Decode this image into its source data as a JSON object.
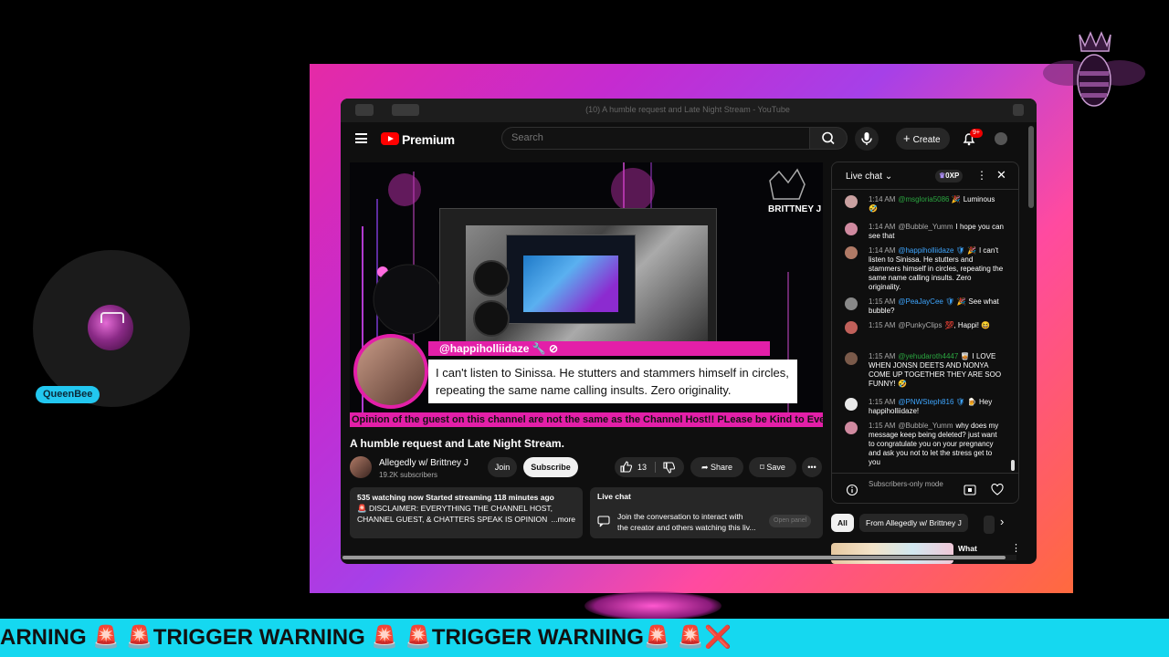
{
  "overlay": {
    "username": "QueenBee",
    "warning_ticker": "ARNING 🚨 🚨TRIGGER WARNING 🚨 🚨TRIGGER WARNING🚨  🚨❌"
  },
  "browser": {
    "tab_title": "(10) A humble request and Late Night Stream - YouTube"
  },
  "topbar": {
    "brand": "Premium",
    "search_placeholder": "Search",
    "create_label": "Create",
    "notification_count": "9+"
  },
  "video": {
    "highlight_author": "@happiholliidaze 🔧 ⊘",
    "highlight_message": "I can't listen to Sinissa. He stutters and stammers himself in circles, repeating the same name calling insults. Zero originality.",
    "ticker": "Opinion of the guest on this channel are not the same as the Channel Host!! PLease be Kind to Eve",
    "watermark": "BRITTNEY J"
  },
  "video_info": {
    "title": "A humble request and Late Night Stream.",
    "channel_name": "Allegedly w/ Brittney J",
    "subscribers": "19.2K subscribers",
    "join_label": "Join",
    "subscribe_label": "Subscribe",
    "like_count": "13",
    "share_label": "Share",
    "save_label": "Save",
    "more_label": "•••"
  },
  "description": {
    "stats": "535 watching now  Started streaming 118 minutes ago",
    "line1": "🚨 DISCLAIMER: EVERYTHING THE CHANNEL HOST,",
    "line2": "CHANNEL GUEST, & CHATTERS SPEAK IS OPINION 🚨",
    "more": "...more"
  },
  "live_chat_box": {
    "title": "Live chat",
    "text_line1": "Join the conversation to interact with",
    "text_line2": "the creator and others watching this liv...",
    "open_panel": "Open panel"
  },
  "chat": {
    "title": "Live chat",
    "xp": "0XP",
    "messages": [
      {
        "time": "1:14 AM",
        "author": "@msgloria5086 🎉",
        "text": "Luminous 🤣",
        "color": "#c9a0a0"
      },
      {
        "time": "1:14 AM",
        "author": "@Bubble_Yumm",
        "text": "I hope you can see that",
        "color": "#d08aa0"
      },
      {
        "time": "1:14 AM",
        "author": "@happiholliidaze 🛡 🎉",
        "text": "I can't listen to Sinissa. He stutters and stammers himself in circles, repeating the same name calling insults. Zero originality.",
        "color": "#b07a66"
      },
      {
        "time": "1:15 AM",
        "author": "@PeaJayCee 🛡 🎉",
        "text": "See what bubble?",
        "color": "#888"
      },
      {
        "time": "1:15 AM",
        "author": "@PunkyClips",
        "text": "💯, Happi! 😆",
        "color": "#c0605a"
      },
      {
        "time": "1:15 AM",
        "author": "@yehudaroth4447 🥃",
        "text": "I LOVE WHEN JONSN DEETS AND NONYA COME UP TOGETHER THEY ARE SOO FUNNY! 🤣",
        "color": "#7a5a4a"
      },
      {
        "time": "1:15 AM",
        "author": "@PNWSteph816 🛡 🍺",
        "text": "Hey happiholliidaze!",
        "color": "#e8e8e8"
      },
      {
        "time": "1:15 AM",
        "author": "@Bubble_Yumm",
        "text": "why does my message keep being deleted? just want to congratulate you on your pregnancy and ask you not to let the stress get to you",
        "color": "#d08aa0"
      }
    ],
    "footer_mode": "Subscribers-only mode"
  },
  "chips": [
    "All",
    "From Allegedly w/ Brittney J"
  ],
  "recommendation": {
    "title": "What"
  },
  "colors": {
    "accent": "#e31fa8",
    "ticker_bg": "#15d8f0",
    "name_pill": "#22c7f0"
  }
}
